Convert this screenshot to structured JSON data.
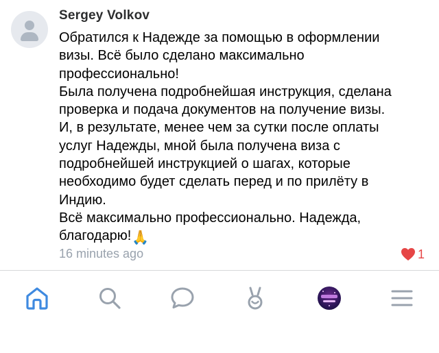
{
  "comment": {
    "author": "Sergey Volkov",
    "body": "Обратился к Надежде за помощью в оформлении\nвизы. Всё было сделано максимально\nпрофессионально!\nБыла получена подробнейшая инструкция, сделана\nпроверка и подача документов на получение визы.\nИ, в результате, менее чем за сутки после оплаты\nуслуг Надежды, мной была получена виза с\nподробнейшей инструкцией о шагах, которые\nнеобходимо будет сделать перед и по прилёту в\nИндию.\nВсё максимально профессионально. Надежда,\nблагодарю!",
    "emoji": "🙏",
    "timestamp": "16 minutes ago",
    "likes": "1"
  },
  "tabbar": {
    "items": [
      {
        "name": "home",
        "icon": "home-icon",
        "active": true
      },
      {
        "name": "search",
        "icon": "search-icon",
        "active": false
      },
      {
        "name": "messages",
        "icon": "chat-bubble-icon",
        "active": false
      },
      {
        "name": "clips",
        "icon": "clips-icon",
        "active": false
      },
      {
        "name": "profile",
        "icon": "profile-avatar-icon",
        "active": false
      },
      {
        "name": "menu",
        "icon": "menu-icon",
        "active": false
      }
    ]
  },
  "colors": {
    "accent": "#3f8ae0",
    "icon_gray": "#99a2ad",
    "like_red": "#e64646",
    "text": "#000000",
    "secondary_text": "#99a2ad"
  }
}
